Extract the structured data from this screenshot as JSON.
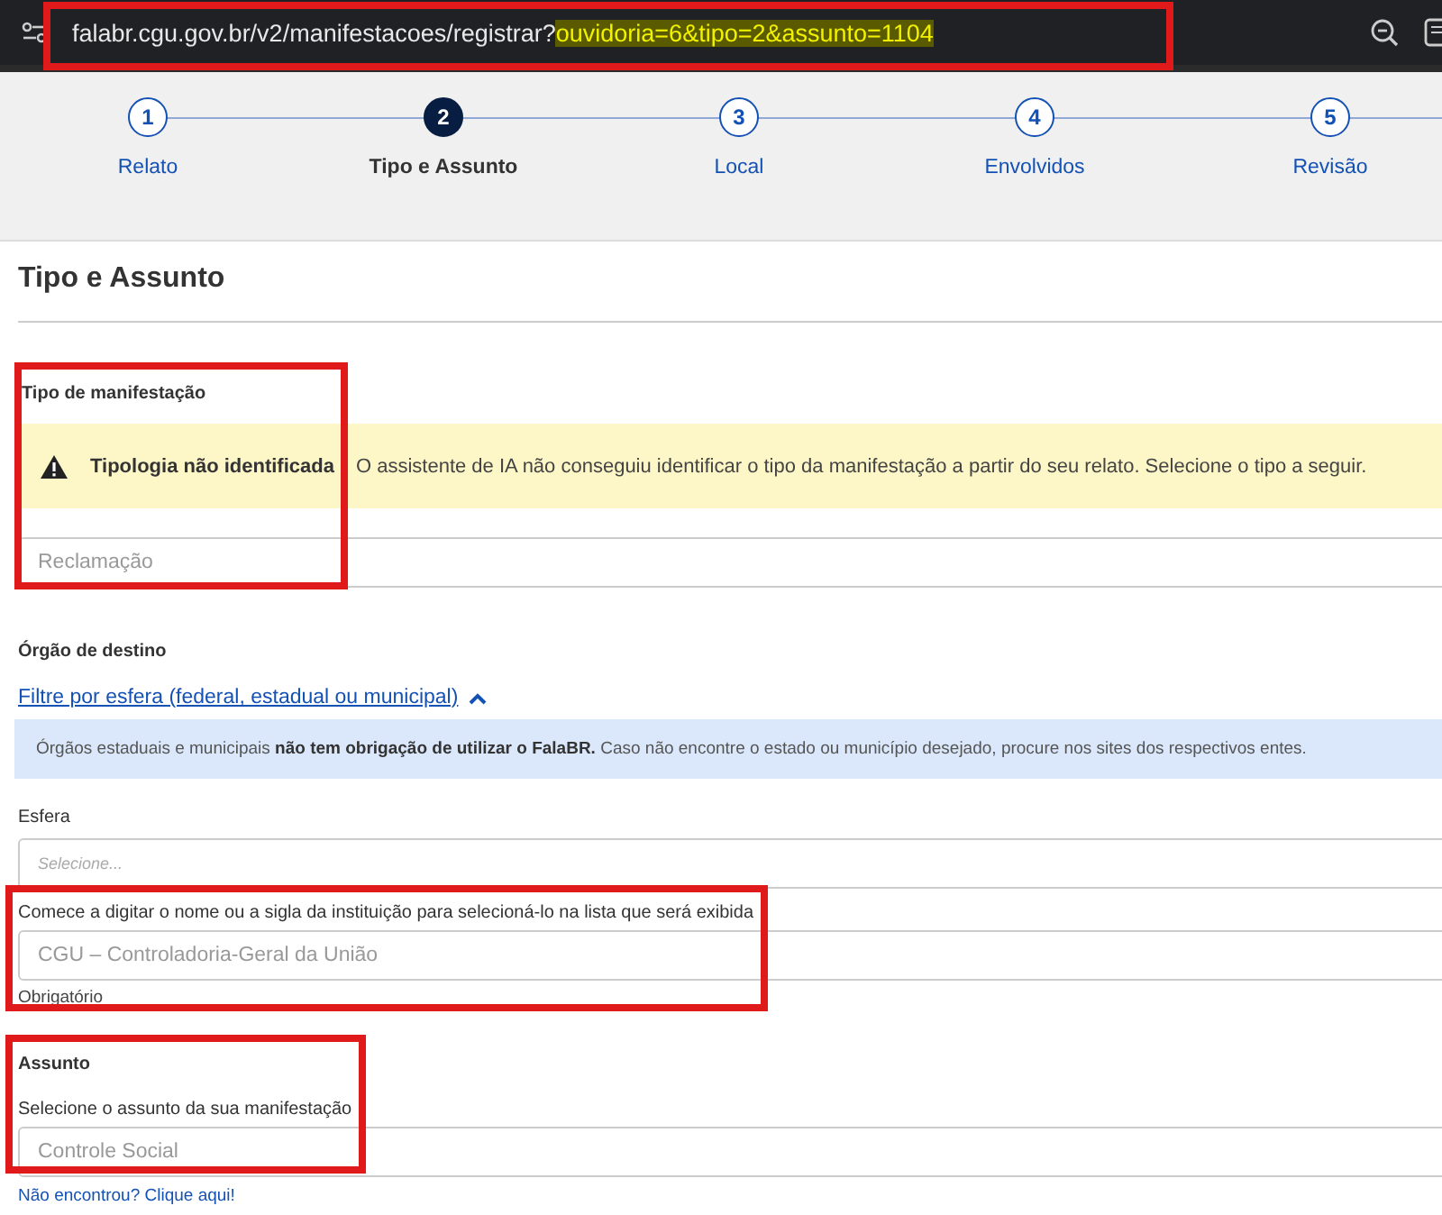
{
  "address_bar": {
    "url": "falabr.cgu.gov.br/v2/manifestacoes/registrar?",
    "url_highlight": "ouvidoria=6&tipo=2&assunto=1104",
    "highlighted": true
  },
  "steps": [
    {
      "number": "1",
      "label": "Relato",
      "selected": false
    },
    {
      "number": "2",
      "label": "Tipo e Assunto",
      "selected": true
    },
    {
      "number": "3",
      "label": "Local",
      "selected": false
    },
    {
      "number": "4",
      "label": "Envolvidos",
      "selected": false
    },
    {
      "number": "5",
      "label": "Revisão",
      "selected": false
    }
  ],
  "heading": "Tipo e Assunto",
  "tipo": {
    "label": "Tipo de manifestação",
    "highlighted": true,
    "alert": {
      "title": "Tipologia não identificada",
      "text": "O assistente de IA não conseguiu identificar o tipo da manifestação a partir do seu relato. Selecione o tipo a seguir."
    },
    "value": "Reclamação"
  },
  "orgao": {
    "label": "Órgão de destino",
    "filter_link": "Filtre por esfera (federal, estadual ou municipal)",
    "filter_expanded": true,
    "info": "Órgãos estaduais e municipais **não tem obrigação de utilizar o FalaBR.** Caso não encontre o estado ou município desejado, procure nos sites dos respectivos entes.",
    "esfera": {
      "label": "Esfera",
      "placeholder": "Selecione..."
    },
    "instituicao": {
      "label": "Comece a digitar o nome ou a sigla da instituição para selecioná-lo na lista que será exibida",
      "value": "CGU – Controladoria-Geral da União",
      "hint": "Obrigatório",
      "highlighted": true
    }
  },
  "assunto": {
    "label": "Assunto",
    "sublabel": "Selecione o assunto da sua manifestação",
    "value": "Controle Social",
    "link": "Não encontrou? Clique aqui!",
    "highlighted": true
  }
}
